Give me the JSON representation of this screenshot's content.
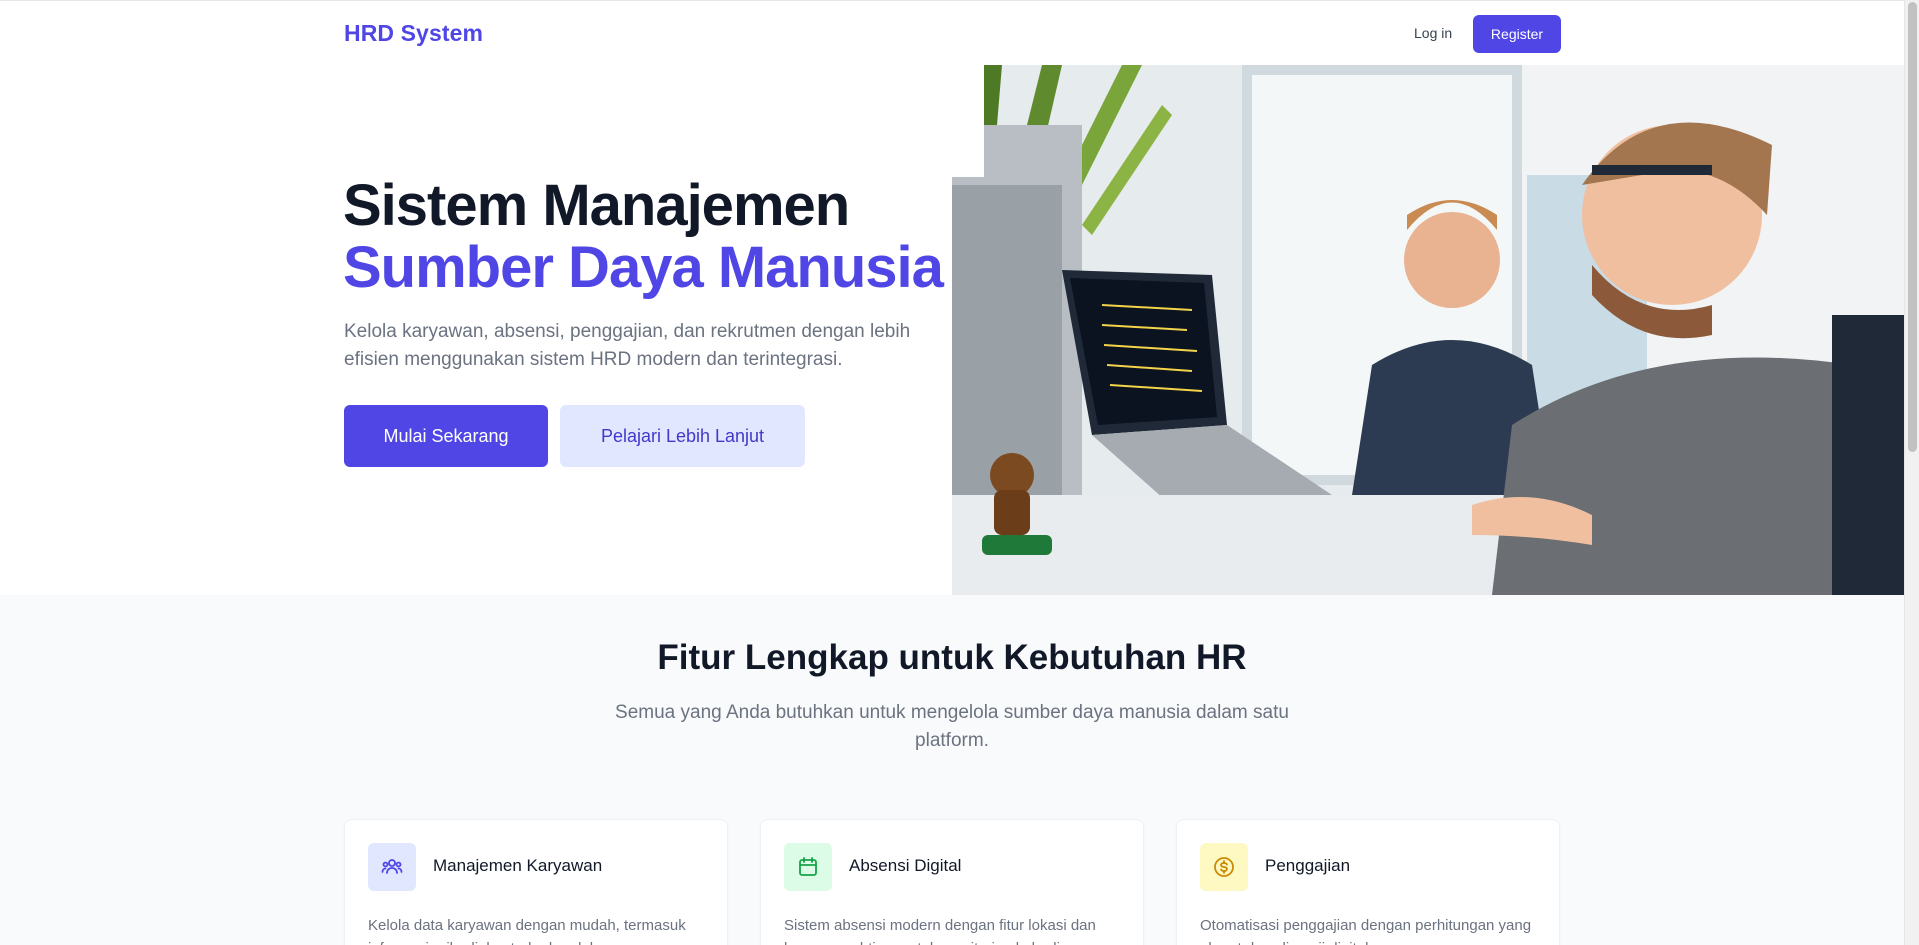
{
  "nav": {
    "brand": "HRD System",
    "login": "Log in",
    "register": "Register"
  },
  "hero": {
    "title_line1": "Sistem Manajemen",
    "title_line2": "Sumber Daya Manusia",
    "description": "Kelola karyawan, absensi, penggajian, dan rekrutmen dengan lebih efisien menggunakan sistem HRD modern dan terintegrasi.",
    "primary_button": "Mulai Sekarang",
    "secondary_button": "Pelajari Lebih Lanjut"
  },
  "features": {
    "title": "Fitur Lengkap untuk Kebutuhan HR",
    "subtitle": "Semua yang Anda butuhkan untuk mengelola sumber daya manusia dalam satu platform.",
    "cards": [
      {
        "title": "Manajemen Karyawan",
        "description": "Kelola data karyawan dengan mudah, termasuk informasi pribadi, kontrak, dan dokumen.",
        "icon": "users-icon",
        "icon_bg": "#e0e7ff",
        "icon_color": "#4f46e5"
      },
      {
        "title": "Absensi Digital",
        "description": "Sistem absensi modern dengan fitur lokasi dan laporan real-time untuk monitoring kehadiran.",
        "icon": "calendar-icon",
        "icon_bg": "#dcfce7",
        "icon_color": "#16a34a"
      },
      {
        "title": "Penggajian",
        "description": "Otomatisasi penggajian dengan perhitungan yang akurat dan slip gaji digital.",
        "icon": "currency-icon",
        "icon_bg": "#fef9c3",
        "icon_color": "#ca8a04"
      }
    ]
  },
  "colors": {
    "accent": "#4f46e5",
    "accent_light": "#e0e7ff"
  }
}
